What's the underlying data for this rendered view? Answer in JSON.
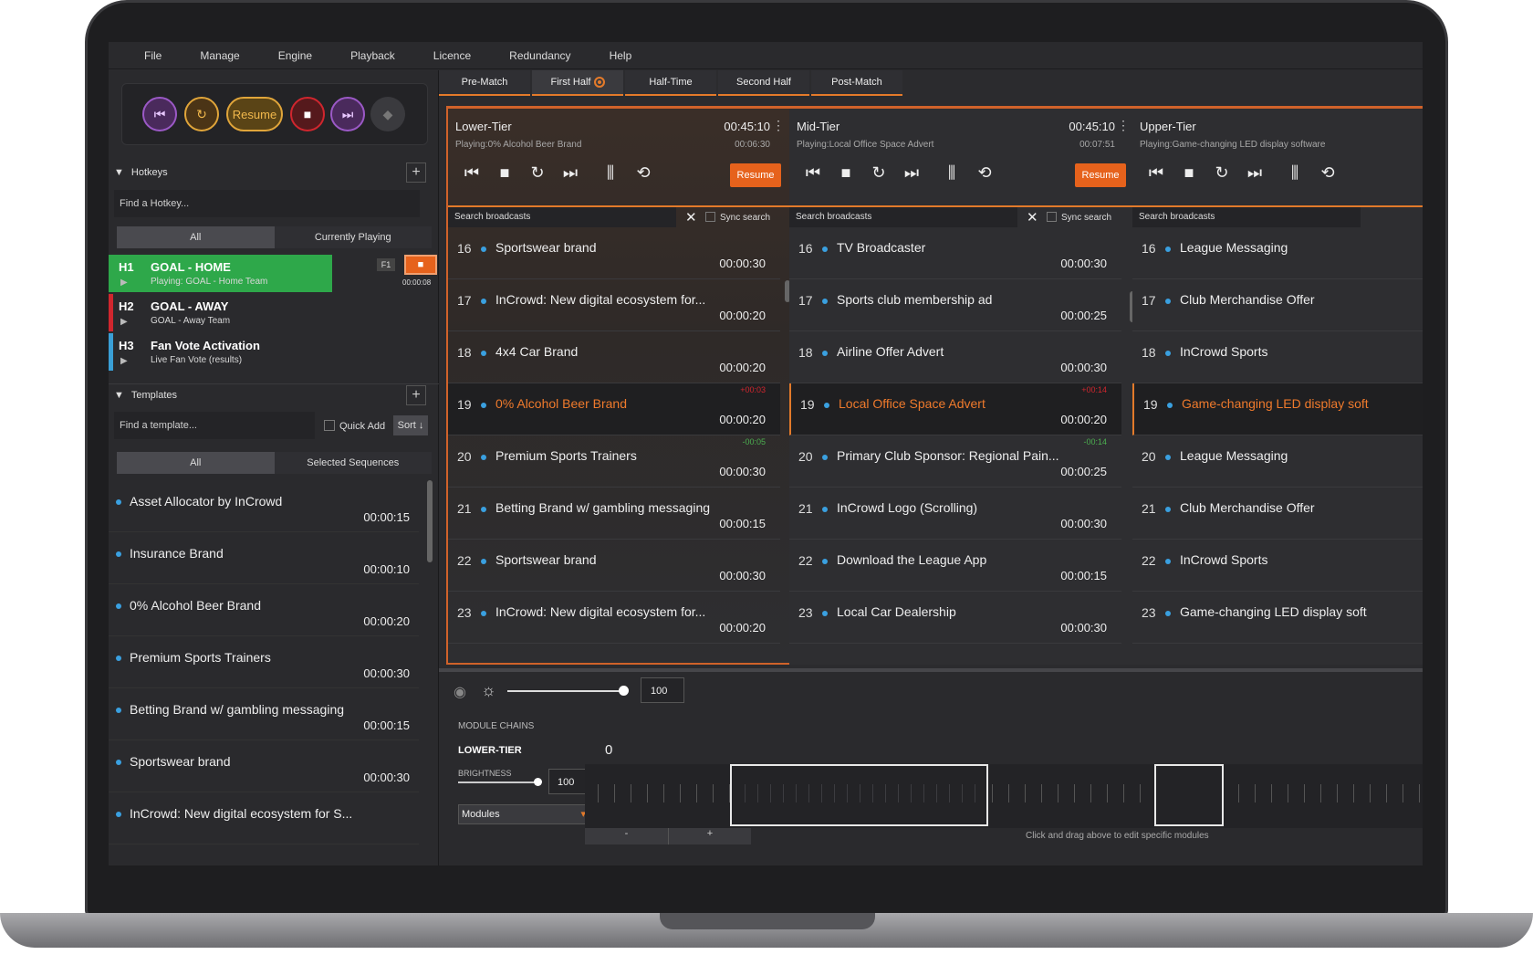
{
  "menu": [
    "File",
    "Manage",
    "Engine",
    "Playback",
    "Licence",
    "Redundancy",
    "Help"
  ],
  "transport": {
    "resume_label": "Resume"
  },
  "hotkeys": {
    "header": "Hotkeys",
    "search_placeholder": "Find a Hotkey...",
    "filters": [
      "All",
      "Currently Playing"
    ],
    "items": [
      {
        "code": "H1",
        "title": "GOAL - HOME",
        "sub": "Playing: GOAL - Home Team",
        "key": "F1",
        "time": "00:00:08",
        "color": "#2ea84a"
      },
      {
        "code": "H2",
        "title": "GOAL - AWAY",
        "sub": "GOAL - Away Team",
        "color": "#d0262e"
      },
      {
        "code": "H3",
        "title": "Fan Vote Activation",
        "sub": "Live Fan Vote (results)",
        "color": "#3a9fd6"
      }
    ]
  },
  "templates": {
    "header": "Templates",
    "search_placeholder": "Find a template...",
    "quick_add": "Quick Add",
    "sort": "Sort ↓",
    "filters": [
      "All",
      "Selected Sequences"
    ],
    "items": [
      {
        "name": "Asset Allocator by InCrowd",
        "dur": "00:00:15"
      },
      {
        "name": "Insurance Brand",
        "dur": "00:00:10"
      },
      {
        "name": "0% Alcohol Beer Brand",
        "dur": "00:00:20"
      },
      {
        "name": "Premium Sports Trainers",
        "dur": "00:00:30"
      },
      {
        "name": "Betting Brand w/ gambling messaging",
        "dur": "00:00:15"
      },
      {
        "name": "Sportswear brand",
        "dur": "00:00:30"
      },
      {
        "name": "InCrowd: New digital ecosystem for S...",
        "dur": ""
      }
    ]
  },
  "tabs": [
    "Pre-Match",
    "First Half",
    "Half-Time",
    "Second Half",
    "Post-Match"
  ],
  "panels": [
    {
      "name": "Lower-Tier",
      "time": "00:45:10",
      "playing": "Playing:0% Alcohol Beer Brand",
      "elapsed": "00:06:30",
      "resume": "Resume",
      "search": "Search broadcasts",
      "sync": "Sync search",
      "items": [
        {
          "n": "16",
          "name": "Sportswear brand",
          "dur": "00:00:30"
        },
        {
          "n": "17",
          "name": "InCrowd: New digital ecosystem for...",
          "dur": "00:00:20"
        },
        {
          "n": "18",
          "name": "4x4 Car Brand",
          "dur": "00:00:20"
        },
        {
          "n": "19",
          "name": "0% Alcohol Beer Brand",
          "dur": "00:00:20",
          "off": "+00:03",
          "sel": true
        },
        {
          "n": "20",
          "name": "Premium Sports Trainers",
          "dur": "00:00:30",
          "off": "-00:05"
        },
        {
          "n": "21",
          "name": "Betting Brand w/ gambling messaging",
          "dur": "00:00:15"
        },
        {
          "n": "22",
          "name": "Sportswear brand",
          "dur": "00:00:30"
        },
        {
          "n": "23",
          "name": "InCrowd: New digital ecosystem for...",
          "dur": "00:00:20"
        }
      ]
    },
    {
      "name": "Mid-Tier",
      "time": "00:45:10",
      "playing": "Playing:Local Office Space Advert",
      "elapsed": "00:07:51",
      "resume": "Resume",
      "search": "Search broadcasts",
      "sync": "Sync search",
      "items": [
        {
          "n": "16",
          "name": "TV Broadcaster",
          "dur": "00:00:30"
        },
        {
          "n": "17",
          "name": "Sports club membership ad",
          "dur": "00:00:25"
        },
        {
          "n": "18",
          "name": "Airline Offer Advert",
          "dur": "00:00:30"
        },
        {
          "n": "19",
          "name": "Local Office Space Advert",
          "dur": "00:00:20",
          "off": "+00:14",
          "sel": true
        },
        {
          "n": "20",
          "name": "Primary Club Sponsor: Regional Pain...",
          "dur": "00:00:25",
          "off": "-00:14"
        },
        {
          "n": "21",
          "name": "InCrowd Logo (Scrolling)",
          "dur": "00:00:30"
        },
        {
          "n": "22",
          "name": "Download the League App",
          "dur": "00:00:15"
        },
        {
          "n": "23",
          "name": "Local Car Dealership",
          "dur": "00:00:30"
        }
      ]
    },
    {
      "name": "Upper-Tier",
      "time": "",
      "playing": "Playing:Game-changing LED display software",
      "elapsed": "",
      "resume": "",
      "search": "Search broadcasts",
      "sync": "",
      "items": [
        {
          "n": "16",
          "name": "League Messaging",
          "dur": ""
        },
        {
          "n": "17",
          "name": "Club Merchandise Offer",
          "dur": ""
        },
        {
          "n": "18",
          "name": "InCrowd Sports",
          "dur": ""
        },
        {
          "n": "19",
          "name": "Game-changing LED display soft",
          "dur": "",
          "sel": true
        },
        {
          "n": "20",
          "name": "League Messaging",
          "dur": ""
        },
        {
          "n": "21",
          "name": "Club Merchandise Offer",
          "dur": ""
        },
        {
          "n": "22",
          "name": "InCrowd Sports",
          "dur": ""
        },
        {
          "n": "23",
          "name": "Game-changing LED display soft",
          "dur": ""
        }
      ]
    }
  ],
  "bottom": {
    "brightness_value": "100",
    "module_chains": "MODULE CHAINS",
    "tier": "LOWER-TIER",
    "tier_value": "0",
    "brightness_label": "BRIGHTNESS",
    "brightness_small": "100",
    "modules_select": "Modules",
    "minus": "-",
    "plus": "+",
    "hint": "Click and drag above to edit specific modules"
  }
}
